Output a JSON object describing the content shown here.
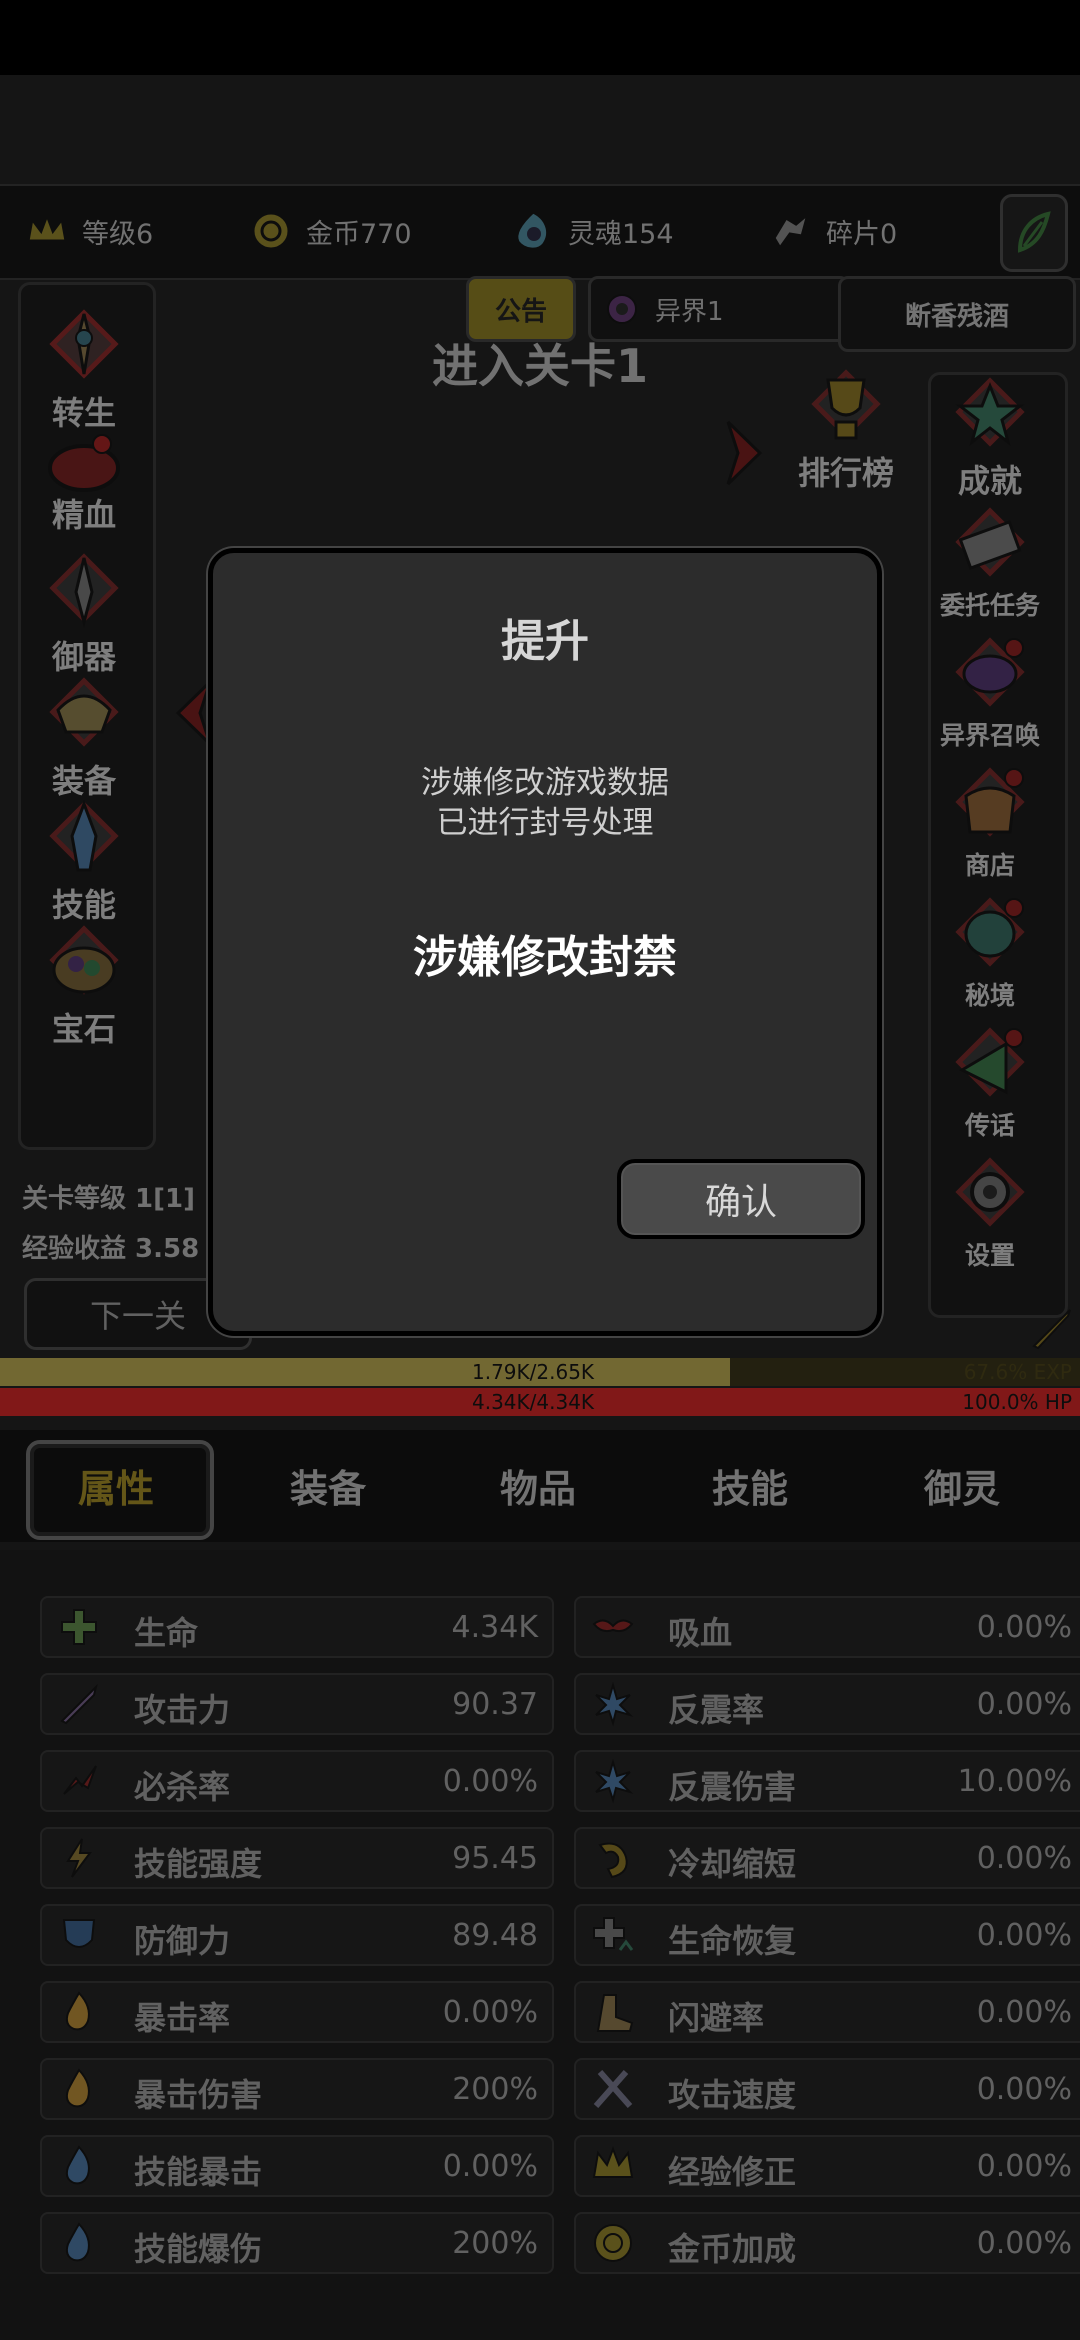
{
  "resources": [
    {
      "label": "等级6",
      "icon": "crown-icon"
    },
    {
      "label": "金币770",
      "icon": "coin-icon"
    },
    {
      "label": "灵魂154",
      "icon": "soul-icon"
    },
    {
      "label": "碎片0",
      "icon": "shard-icon"
    }
  ],
  "header": {
    "announcement": "公告",
    "realm": "异界1",
    "player_name": "断香残酒",
    "stage_title": "进入关卡1"
  },
  "left_menu": [
    {
      "label": "转生",
      "icon": "rebirth-icon"
    },
    {
      "label": "精血",
      "icon": "blood-essence-icon"
    },
    {
      "label": "御器",
      "icon": "artifact-icon"
    },
    {
      "label": "装备",
      "icon": "equipment-icon"
    },
    {
      "label": "技能",
      "icon": "skill-crystal-icon"
    },
    {
      "label": "宝石",
      "icon": "gem-bag-icon"
    }
  ],
  "leaderboard": {
    "label": "排行榜",
    "icon": "trophy-icon"
  },
  "right_menu": [
    {
      "label": "成就",
      "icon": "star-icon"
    },
    {
      "label": "委托任务",
      "icon": "scroll-icon"
    },
    {
      "label": "异界召唤",
      "icon": "portal-icon"
    },
    {
      "label": "商店",
      "icon": "shop-bag-icon"
    },
    {
      "label": "秘境",
      "icon": "secret-realm-icon"
    },
    {
      "label": "传话",
      "icon": "megaphone-icon"
    },
    {
      "label": "设置",
      "icon": "gear-icon"
    }
  ],
  "stage_info": {
    "level": "关卡等级 1[1]",
    "exp_gain": "经验收益 3.58",
    "next_button": "下一关"
  },
  "bars": {
    "exp_text": "1.79K/2.65K",
    "exp_percent": "67.6% EXP",
    "exp_fraction": 0.676,
    "hp_text": "4.34K/4.34K",
    "hp_percent": "100.0%  HP",
    "hp_fraction": 1.0
  },
  "tabs": [
    "属性",
    "装备",
    "物品",
    "技能",
    "御灵"
  ],
  "stats_left": [
    {
      "name": "生命",
      "value": "4.34K",
      "icon": "health-cross-icon"
    },
    {
      "name": "攻击力",
      "value": "90.37",
      "icon": "sword-icon"
    },
    {
      "name": "必杀率",
      "value": "0.00%",
      "icon": "crit-splash-icon"
    },
    {
      "name": "技能强度",
      "value": "95.45",
      "icon": "lightning-icon"
    },
    {
      "name": "防御力",
      "value": "89.48",
      "icon": "shield-icon"
    },
    {
      "name": "暴击率",
      "value": "0.00%",
      "icon": "fire-icon"
    },
    {
      "name": "暴击伤害",
      "value": "200%",
      "icon": "fire-icon"
    },
    {
      "name": "技能暴击",
      "value": "0.00%",
      "icon": "blue-fire-icon"
    },
    {
      "name": "技能爆伤",
      "value": "200%",
      "icon": "blue-fire-icon"
    }
  ],
  "stats_right": [
    {
      "name": "吸血",
      "value": "0.00%",
      "icon": "bat-icon"
    },
    {
      "name": "反震率",
      "value": "0.00%",
      "icon": "ice-burst-icon"
    },
    {
      "name": "反震伤害",
      "value": "10.00%",
      "icon": "ice-burst-icon"
    },
    {
      "name": "冷却缩短",
      "value": "0.00%",
      "icon": "cooldown-icon"
    },
    {
      "name": "生命恢复",
      "value": "0.00%",
      "icon": "regen-cross-icon"
    },
    {
      "name": "闪避率",
      "value": "0.00%",
      "icon": "boot-icon"
    },
    {
      "name": "攻击速度",
      "value": "0.00%",
      "icon": "crossed-swords-icon"
    },
    {
      "name": "经验修正",
      "value": "0.00%",
      "icon": "crown-icon"
    },
    {
      "name": "金币加成",
      "value": "0.00%",
      "icon": "coin-icon"
    }
  ],
  "dialog": {
    "title": "提升",
    "message_line1": "涉嫌修改游戏数据",
    "message_line2": "已进行封号处理",
    "headline": "涉嫌修改封禁",
    "confirm": "确认"
  },
  "colors": {
    "exp_bar": "#8c7f3e",
    "hp_bar": "#9e1e1e",
    "active_tab": "#7a6a1e",
    "dialog_bg": "#2c2c2c"
  }
}
